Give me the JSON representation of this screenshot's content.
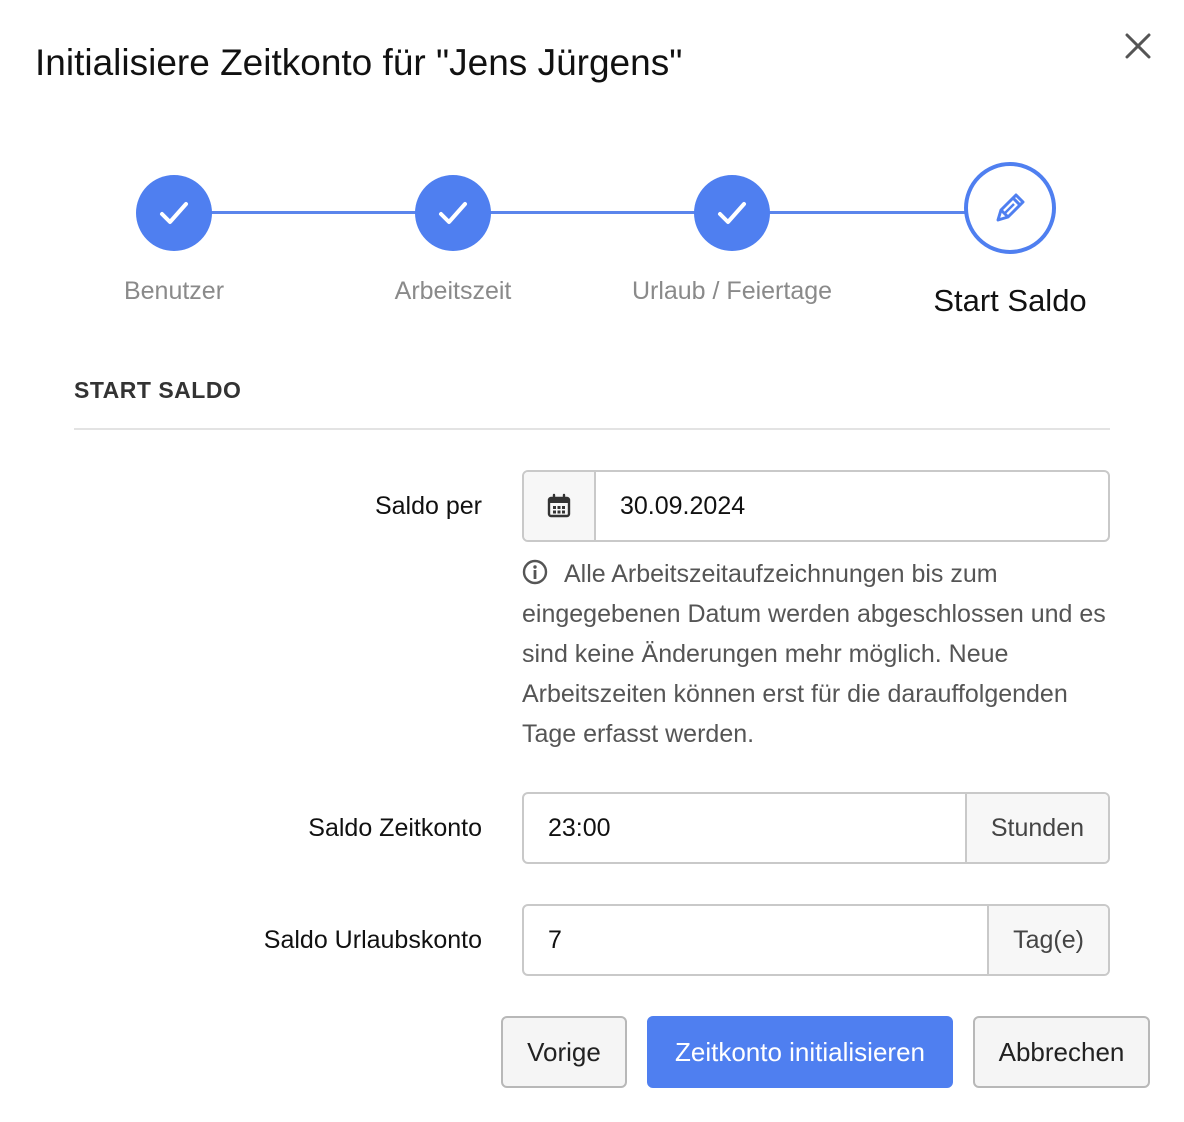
{
  "dialog": {
    "title": "Initialisiere Zeitkonto für \"Jens Jürgens\""
  },
  "stepper": {
    "steps": [
      {
        "label": "Benutzer",
        "state": "done",
        "icon": "check-icon"
      },
      {
        "label": "Arbeitszeit",
        "state": "done",
        "icon": "check-icon"
      },
      {
        "label": "Urlaub / Feiertage",
        "state": "done",
        "icon": "check-icon"
      },
      {
        "label": "Start Saldo",
        "state": "active",
        "icon": "pencil-icon"
      }
    ],
    "accent_color": "#4f7ff0"
  },
  "section": {
    "title": "START SALDO"
  },
  "fields": {
    "saldo_per": {
      "label": "Saldo per",
      "value": "30.09.2024",
      "icon": "calendar-icon"
    },
    "info_text": "Alle Arbeitszeitaufzeichnungen bis zum eingegebenen Datum werden abgeschlossen und es sind keine Änderungen mehr möglich. Neue Arbeitszeiten können erst für die darauffolgenden Tage erfasst werden.",
    "saldo_zeitkonto": {
      "label": "Saldo Zeitkonto",
      "value": "23:00",
      "unit": "Stunden"
    },
    "saldo_urlaubskonto": {
      "label": "Saldo Urlaubskonto",
      "value": "7",
      "unit": "Tag(e)"
    }
  },
  "buttons": {
    "previous": "Vorige",
    "submit": "Zeitkonto initialisieren",
    "cancel": "Abbrechen"
  }
}
